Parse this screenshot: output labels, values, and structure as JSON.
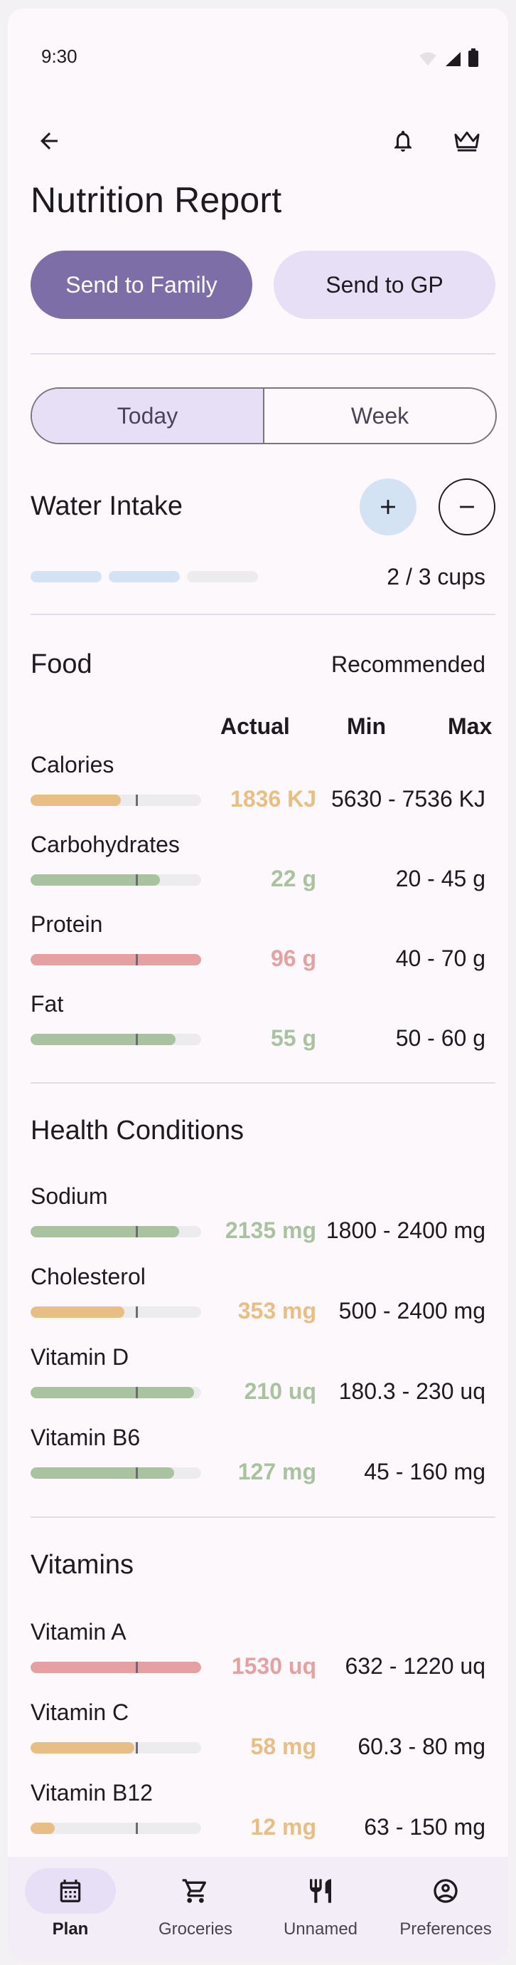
{
  "status_bar": {
    "time": "9:30"
  },
  "header": {
    "title": "Nutrition Report"
  },
  "actions": {
    "send_family": "Send to Family",
    "send_gp": "Send to GP"
  },
  "tabs": [
    {
      "label": "Today",
      "selected": true
    },
    {
      "label": "Week",
      "selected": false
    }
  ],
  "water": {
    "title": "Water Intake",
    "value": "2 / 3 cups",
    "filled": 2,
    "total": 3
  },
  "food": {
    "title": "Food",
    "recommended_label": "Recommended",
    "col_actual": "Actual",
    "col_min": "Min",
    "col_max": "Max",
    "rows": [
      {
        "label": "Calories",
        "actual": "1836 KJ",
        "range": "5630 - 7536 KJ",
        "status": "low",
        "level": 0.53
      },
      {
        "label": "Carbohydrates",
        "actual": "22 g",
        "range": "20 - 45 g",
        "status": "ok",
        "level": 0.76
      },
      {
        "label": "Protein",
        "actual": "96 g",
        "range": "40 - 70 g",
        "status": "high",
        "level": 1.0
      },
      {
        "label": "Fat",
        "actual": "55 g",
        "range": "50 - 60 g",
        "status": "ok",
        "level": 0.85
      }
    ]
  },
  "health": {
    "title": "Health Conditions",
    "rows": [
      {
        "label": "Sodium",
        "actual": "2135 mg",
        "range": "1800 - 2400 mg",
        "status": "ok",
        "level": 0.87
      },
      {
        "label": "Cholesterol",
        "actual": "353 mg",
        "range": "500 - 2400 mg",
        "status": "low",
        "level": 0.55
      },
      {
        "label": "Vitamin D",
        "actual": "210 uq",
        "range": "180.3 - 230 uq",
        "status": "ok",
        "level": 0.96
      },
      {
        "label": "Vitamin B6",
        "actual": "127 mg",
        "range": "45 - 160 mg",
        "status": "ok",
        "level": 0.84
      }
    ]
  },
  "vitamins": {
    "title": "Vitamins",
    "rows": [
      {
        "label": "Vitamin A",
        "actual": "1530 uq",
        "range": "632 - 1220 uq",
        "status": "high",
        "level": 1.0
      },
      {
        "label": "Vitamin C",
        "actual": "58 mg",
        "range": "60.3 - 80 mg",
        "status": "low",
        "level": 0.61
      },
      {
        "label": "Vitamin B12",
        "actual": "12 mg",
        "range": "63 - 150 mg",
        "status": "low",
        "level": 0.14
      }
    ]
  },
  "colors": {
    "ok": "#a9c29f",
    "low": "#e8be85",
    "high": "#e5a1a1",
    "water_filled": "#d3e3f4",
    "water_empty": "#ececee"
  },
  "nav": [
    {
      "label": "Plan",
      "icon": "calendar-icon",
      "active": true
    },
    {
      "label": "Groceries",
      "icon": "cart-icon",
      "active": false
    },
    {
      "label": "Unnamed",
      "icon": "restaurant-icon",
      "active": false
    },
    {
      "label": "Preferences",
      "icon": "account-circle-icon",
      "active": false
    }
  ]
}
